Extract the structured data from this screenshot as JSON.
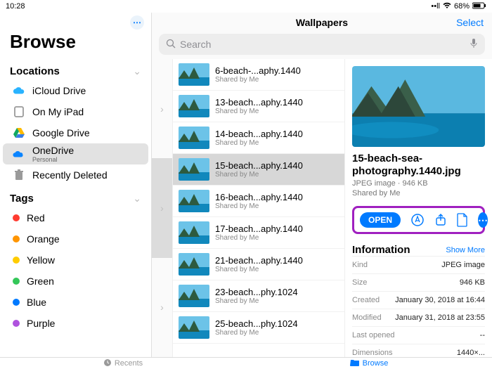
{
  "statusbar": {
    "time": "10:28",
    "battery": "68%"
  },
  "sidebar": {
    "title": "Browse",
    "locations_header": "Locations",
    "tags_header": "Tags",
    "locations": [
      {
        "name": "iCloud Drive",
        "icon": "cloud",
        "color": "#29b3ff"
      },
      {
        "name": "On My iPad",
        "icon": "ipad",
        "color": "#9a9a9a"
      },
      {
        "name": "Google Drive",
        "icon": "gdrive",
        "color": "#ffbb00"
      },
      {
        "name": "OneDrive",
        "sub": "Personal",
        "icon": "onedrive",
        "color": "#0a84ff",
        "selected": true
      },
      {
        "name": "Recently Deleted",
        "icon": "trash",
        "color": "#9a9a9a"
      }
    ],
    "tags": [
      {
        "name": "Red",
        "color": "#ff3b30"
      },
      {
        "name": "Orange",
        "color": "#ff9500"
      },
      {
        "name": "Yellow",
        "color": "#ffcc00"
      },
      {
        "name": "Green",
        "color": "#34c759"
      },
      {
        "name": "Blue",
        "color": "#007aff"
      },
      {
        "name": "Purple",
        "color": "#af52de"
      }
    ]
  },
  "mid": {
    "title": "Wallpapers",
    "select_label": "Select",
    "search_placeholder": "Search",
    "files": [
      {
        "name": "6-beach-...aphy.1440",
        "sub": "Shared by Me"
      },
      {
        "name": "13-beach...aphy.1440",
        "sub": "Shared by Me"
      },
      {
        "name": "14-beach...aphy.1440",
        "sub": "Shared by Me"
      },
      {
        "name": "15-beach...aphy.1440",
        "sub": "Shared by Me",
        "selected": true
      },
      {
        "name": "16-beach...aphy.1440",
        "sub": "Shared by Me"
      },
      {
        "name": "17-beach...aphy.1440",
        "sub": "Shared by Me"
      },
      {
        "name": "21-beach...aphy.1440",
        "sub": "Shared by Me"
      },
      {
        "name": "23-beach...phy.1024",
        "sub": "Shared by Me"
      },
      {
        "name": "25-beach...phy.1024",
        "sub": "Shared by Me"
      }
    ]
  },
  "detail": {
    "title": "15-beach-sea-photography.1440.jpg",
    "subtitle": "JPEG image · 946 KB",
    "shared": "Shared by Me",
    "open_label": "OPEN",
    "info_header": "Information",
    "show_more": "Show More",
    "info": [
      {
        "k": "Kind",
        "v": "JPEG image"
      },
      {
        "k": "Size",
        "v": "946 KB"
      },
      {
        "k": "Created",
        "v": "January 30, 2018 at 16:44"
      },
      {
        "k": "Modified",
        "v": "January 31, 2018 at 23:55"
      },
      {
        "k": "Last opened",
        "v": "--"
      },
      {
        "k": "Dimensions",
        "v": "1440×..."
      }
    ]
  },
  "tabbar": {
    "recents": "Recents",
    "browse": "Browse"
  }
}
